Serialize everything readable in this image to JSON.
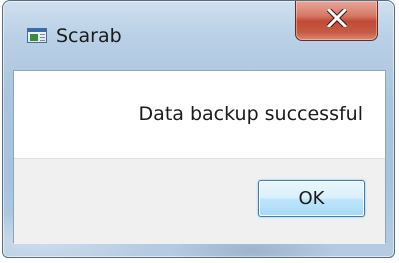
{
  "window": {
    "title": "Scarab",
    "icon": "application-window-icon",
    "close_icon": "close-x-icon"
  },
  "dialog": {
    "message": "Data backup successful",
    "ok_label": "OK"
  },
  "colors": {
    "frame": "#a9c4de",
    "close_button": "#c14a35",
    "ok_button_border": "#3c7fb1",
    "footer": "#f0f0f0"
  }
}
